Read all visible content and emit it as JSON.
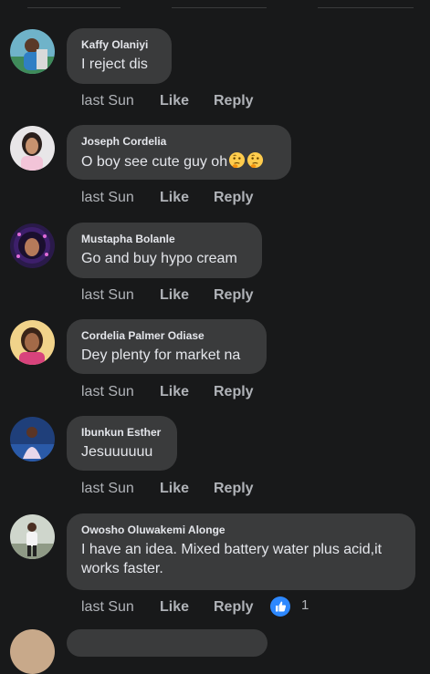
{
  "comments": [
    {
      "author": "Kaffy Olaniyi",
      "text": "I reject dis",
      "time": "last Sun",
      "like": "Like",
      "reply": "Reply"
    },
    {
      "author": "Joseph Cordelia",
      "text": "O boy see cute guy oh",
      "emoji": [
        "thinking-face",
        "thinking-face"
      ],
      "time": "last Sun",
      "like": "Like",
      "reply": "Reply"
    },
    {
      "author": "Mustapha Bolanle",
      "text": "Go and buy hypo cream",
      "time": "last Sun",
      "like": "Like",
      "reply": "Reply"
    },
    {
      "author": "Cordelia Palmer Odiase",
      "text": "Dey plenty for market na",
      "time": "last Sun",
      "like": "Like",
      "reply": "Reply"
    },
    {
      "author": "Ibunkun Esther",
      "text": "Jesuuuuuu",
      "time": "last Sun",
      "like": "Like",
      "reply": "Reply"
    },
    {
      "author": "Owosho Oluwakemi Alonge",
      "text": "I have an idea. Mixed battery water plus acid,it works faster.",
      "time": "last Sun",
      "like": "Like",
      "reply": "Reply",
      "reaction": {
        "icon": "thumbs-up-icon",
        "count": "1"
      }
    }
  ],
  "colors": {
    "background": "#18191a",
    "bubble": "#3a3b3c",
    "text": "#e4e6eb",
    "secondary": "#b0b3b8",
    "like_blue": "#2d88ff"
  }
}
